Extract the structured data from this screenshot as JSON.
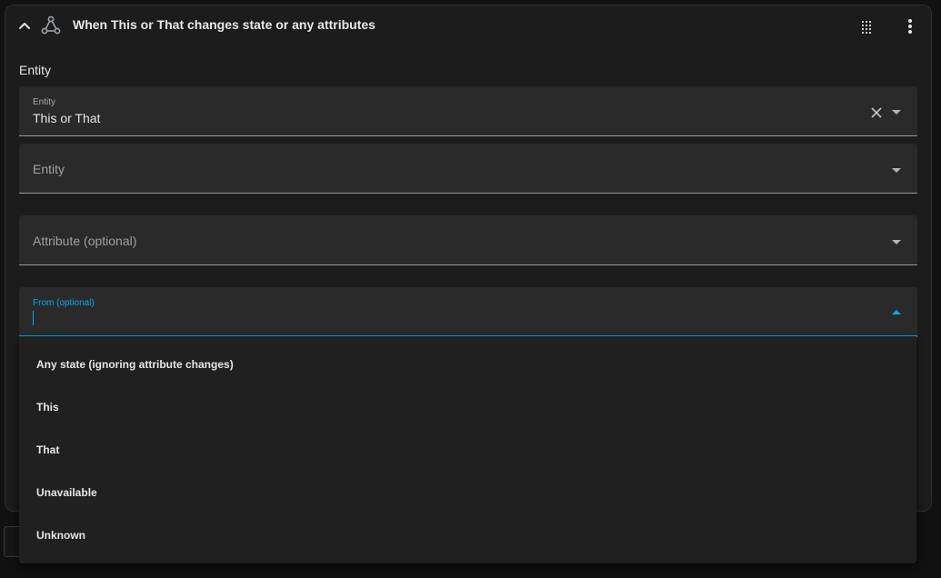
{
  "header": {
    "title": "When This or That changes state or any attributes"
  },
  "section": {
    "label": "Entity"
  },
  "fields": {
    "entity1": {
      "label": "Entity",
      "value": "This or That"
    },
    "entity2": {
      "placeholder": "Entity"
    },
    "attribute": {
      "placeholder": "Attribute (optional)"
    },
    "from": {
      "label": "From (optional)",
      "value": ""
    }
  },
  "dropdown": {
    "options": [
      "Any state (ignoring attribute changes)",
      "This",
      "That",
      "Unavailable",
      "Unknown"
    ]
  },
  "colors": {
    "accent": "#03a9f4",
    "card_background": "#1c1c1c",
    "field_background": "#2a2a2a"
  },
  "icons": {
    "collapse": "chevron-up-icon",
    "trigger": "state-trigger-icon",
    "drag": "drag-handle-icon",
    "menu": "more-vertical-icon",
    "clear": "close-icon",
    "expand": "caret-down-icon"
  }
}
